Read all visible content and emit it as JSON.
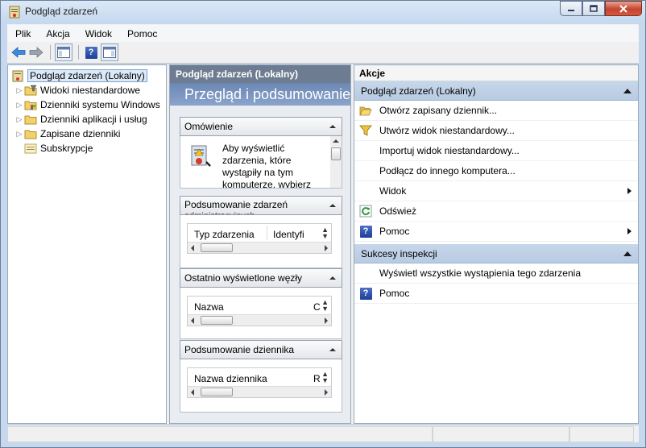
{
  "window": {
    "title": "Podgląd zdarzeń"
  },
  "menu": [
    "Plik",
    "Akcja",
    "Widok",
    "Pomoc"
  ],
  "tree": {
    "root": "Podgląd zdarzeń (Lokalny)",
    "items": [
      "Widoki niestandardowe",
      "Dzienniki systemu Windows",
      "Dzienniki aplikacji i usług",
      "Zapisane dzienniki",
      "Subskrypcje"
    ]
  },
  "middle": {
    "header": "Podgląd zdarzeń (Lokalny)",
    "banner": "Przegląd i podsumowanie",
    "overview": {
      "title": "Omówienie",
      "text_lines": [
        "Aby wyświetlić",
        "zdarzenia, które",
        "wystąpiły na tym",
        "komputerze, wybierz"
      ]
    },
    "summary": {
      "title": "Podsumowanie zdarzeń",
      "title_line2": "administracyjnych",
      "col1": "Typ zdarzenia",
      "col2": "Identyfi"
    },
    "recent": {
      "title": "Ostatnio wyświetlone węzły",
      "col1": "Nazwa",
      "col2": "C"
    },
    "logsum": {
      "title": "Podsumowanie dziennika",
      "col1": "Nazwa dziennika",
      "col2": "R"
    }
  },
  "actions": {
    "header": "Akcje",
    "group1": {
      "title": "Podgląd zdarzeń (Lokalny)",
      "items": [
        "Otwórz zapisany dziennik...",
        "Utwórz widok niestandardowy...",
        "Importuj widok niestandardowy...",
        "Podłącz do innego komputera...",
        "Widok",
        "Odśwież",
        "Pomoc"
      ]
    },
    "group2": {
      "title": "Sukcesy inspekcji",
      "items": [
        "Wyświetl wszystkie wystąpienia tego zdarzenia",
        "Pomoc"
      ]
    }
  }
}
